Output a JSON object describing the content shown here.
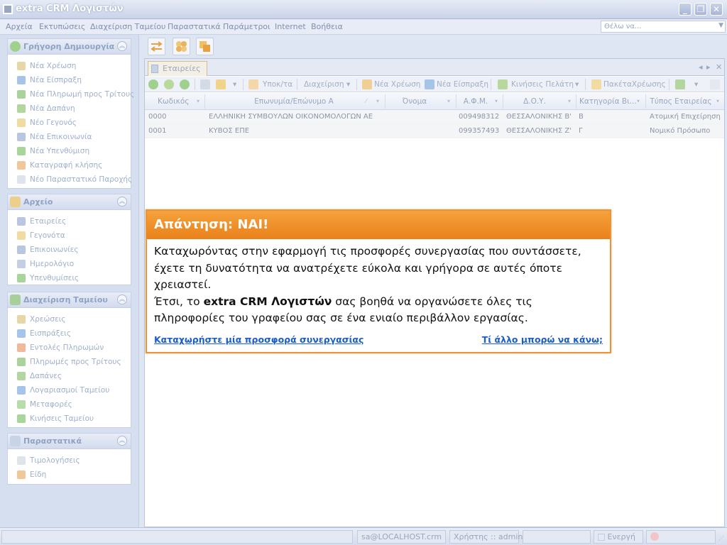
{
  "window": {
    "title": "extra CRM Λογιστών"
  },
  "menu": {
    "items": [
      "Αρχεία",
      "Εκτυπώσεις",
      "Διαχείριση Ταμείου",
      "Παραστατικά",
      "Παράμετροι",
      "Internet",
      "Βοήθεια"
    ],
    "search_placeholder": "Θέλω να..."
  },
  "sidebar": {
    "groups": [
      {
        "title": "Γρήγορη Δημιουργία",
        "items": [
          "Νέα Χρέωση",
          "Νέα Είσπραξη",
          "Νέα Πληρωμή προς Τρίτους",
          "Νέα Δαπάνη",
          "Νέο Γεγονός",
          "Νέα Επικοινωνία",
          "Νέα Υπενθύμιση",
          "Καταγραφή κλήσης",
          "Νέο Παραστατικό Παροχής"
        ]
      },
      {
        "title": "Αρχείο",
        "items": [
          "Εταιρείες",
          "Γεγονότα",
          "Επικοινωνίες",
          "Ημερολόγιο",
          "Υπενθυμίσεις"
        ]
      },
      {
        "title": "Διαχείριση Ταμείου",
        "items": [
          "Χρεώσεις",
          "Εισπράξεις",
          "Εντολές Πληρωμών",
          "Πληρωμές προς Τρίτους",
          "Δαπάνες",
          "Λογαριασμοί Ταμείου",
          "Μεταφορές",
          "Κινήσεις Ταμείου"
        ]
      },
      {
        "title": "Παραστατικά",
        "items": [
          "Τιμολογήσεις",
          "Είδη"
        ]
      }
    ]
  },
  "document": {
    "tab_label": "Εταιρείες",
    "toolbar": {
      "ypokta": "Υποκ/τα",
      "management": "Διαχείριση",
      "new_charge": "Νέα Χρέωση",
      "new_receipt": "Νέα Είσπραξη",
      "client_moves": "Κινήσεις Πελάτη",
      "packages": "ΠακέταΧρέωσης"
    },
    "columns": [
      "Κωδικός",
      "Επωνυμία/Επώνυμο Α",
      "Όνομα",
      "Α.Φ.Μ.",
      "Δ.Ο.Υ.",
      "Κατηγορία Βι...",
      "Τύπος Εταιρείας"
    ],
    "rows": [
      [
        "0000",
        "ΕΛΛΗΝΙΚΗ ΣΥΜΒΟΥΛΩΝ ΟΙΚΟΝΟΜΟΛΟΓΩΝ ΑΕ",
        "",
        "009498312",
        "ΘΕΣΣΑΛΟΝΙΚΗΣ Β'",
        "Β",
        "Ατομική Επιχείρηση"
      ],
      [
        "0001",
        "ΚΥΒΟΣ ΕΠΕ",
        "",
        "099357493",
        "ΘΕΣΣΑΛΟΝΙΚΗΣ Ζ'",
        "Γ",
        "Νομικό Πρόσωπο"
      ]
    ]
  },
  "callout": {
    "title": "Απάντηση: ΝΑΙ!",
    "line1": "Καταχωρόντας στην εφαρμογή τις προσφορές συνεργασίας που συντάσσετε, έχετε τη δυνατότητα να ανατρέχετε εύκολα και γρήγορα σε αυτές όποτε χρειαστεί.",
    "line2_prefix": "Έτσι, το ",
    "line2_bold": "extra CRM Λογιστών",
    "line2_suffix": " σας βοηθά να οργανώσετε όλες τις πληροφορίες του γραφείου σας σε ένα ενιαίο περιβάλλον εργασίας.",
    "link_left": "Καταχωρήστε μία προσφορά συνεργασίας",
    "link_right": "Τί άλλο μπορώ να κάνω;"
  },
  "status": {
    "server": "sa@LOCALHOST.crm",
    "user": "Χρήστης :: admin",
    "state": "Ενεργή"
  }
}
